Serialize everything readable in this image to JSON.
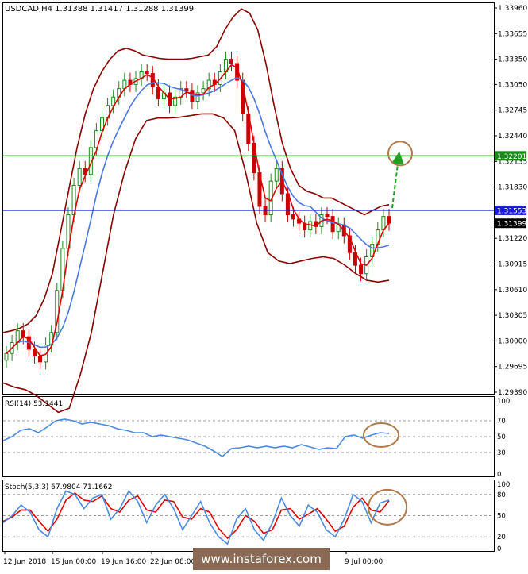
{
  "chart_data": [
    {
      "type": "line",
      "name": "price-panel",
      "title": "USDCAD,H4  1.31388 1.31417 1.31288 1.31399",
      "x_categories": [
        "12 Jun 2018",
        "15 Jun 00:00",
        "19 Jun 16:00",
        "22 Jun 08:00",
        "9 Jul 00:00"
      ],
      "y_ticks": [
        "1.33960",
        "1.33655",
        "1.33350",
        "1.33050",
        "1.32745",
        "1.32440",
        "1.32135",
        "1.31830",
        "1.31220",
        "1.30915",
        "1.30610",
        "1.30305",
        "1.30000",
        "1.29695",
        "1.29390"
      ],
      "ylim": [
        1.2939,
        1.3396
      ],
      "horizontal_levels": [
        {
          "value": 1.32201,
          "label": "1.32201",
          "color": "#1a8a1a"
        },
        {
          "value": 1.31553,
          "label": "1.31553",
          "color": "#1c1cd6"
        },
        {
          "value": 1.31399,
          "label": "1.31399",
          "color": "#000000"
        }
      ],
      "close_series": [
        1.2985,
        1.2998,
        1.3012,
        1.3005,
        1.299,
        1.2982,
        1.2975,
        1.2995,
        1.301,
        1.306,
        1.311,
        1.315,
        1.3185,
        1.3205,
        1.3198,
        1.323,
        1.325,
        1.3265,
        1.328,
        1.329,
        1.33,
        1.331,
        1.3305,
        1.3312,
        1.332,
        1.3318,
        1.3302,
        1.3288,
        1.3295,
        1.328,
        1.329,
        1.33,
        1.3298,
        1.3285,
        1.3295,
        1.33,
        1.331,
        1.3305,
        1.332,
        1.3335,
        1.333,
        1.331,
        1.327,
        1.3235,
        1.32,
        1.316,
        1.315,
        1.319,
        1.3205,
        1.3175,
        1.315,
        1.3145,
        1.314,
        1.3132,
        1.3142,
        1.3136,
        1.315,
        1.3148,
        1.313,
        1.3138,
        1.3125,
        1.3105,
        1.309,
        1.308,
        1.31,
        1.3115,
        1.3132,
        1.3148,
        1.314
      ],
      "bollinger_upper": [
        1.301,
        1.3012,
        1.3015,
        1.302,
        1.303,
        1.305,
        1.308,
        1.313,
        1.318,
        1.323,
        1.327,
        1.33,
        1.332,
        1.3335,
        1.3345,
        1.3348,
        1.3345,
        1.334,
        1.3338,
        1.3336,
        1.3335,
        1.3335,
        1.3335,
        1.3336,
        1.3338,
        1.334,
        1.335,
        1.337,
        1.3385,
        1.3395,
        1.339,
        1.337,
        1.333,
        1.328,
        1.3235,
        1.3205,
        1.3185,
        1.3178,
        1.3175,
        1.317,
        1.317,
        1.3165,
        1.316,
        1.3155,
        1.315,
        1.3155,
        1.316,
        1.3162
      ],
      "bollinger_lower": [
        1.295,
        1.2945,
        1.2942,
        1.2935,
        1.2925,
        1.2915,
        1.292,
        1.296,
        1.301,
        1.308,
        1.315,
        1.32,
        1.324,
        1.3262,
        1.3265,
        1.3265,
        1.3266,
        1.3268,
        1.327,
        1.327,
        1.3265,
        1.325,
        1.32,
        1.314,
        1.3105,
        1.3095,
        1.3092,
        1.3095,
        1.3098,
        1.31,
        1.3098,
        1.309,
        1.308,
        1.3072,
        1.307,
        1.3072
      ]
    },
    {
      "type": "line",
      "name": "rsi-panel",
      "title": "RSI(14) 53.1441",
      "y_ticks": [
        "70",
        "50",
        "30",
        "0",
        "100"
      ],
      "ylim": [
        0,
        100
      ],
      "series": [
        {
          "name": "RSI(14)",
          "values": [
            45,
            50,
            58,
            60,
            55,
            62,
            70,
            72,
            70,
            66,
            68,
            66,
            64,
            60,
            58,
            55,
            55,
            50,
            52,
            50,
            48,
            46,
            42,
            38,
            32,
            25,
            35,
            36,
            38,
            36,
            38,
            36,
            38,
            36,
            40,
            37,
            34,
            36,
            35,
            50,
            52,
            48,
            52,
            55,
            54
          ]
        }
      ]
    },
    {
      "type": "line",
      "name": "stochastic-panel",
      "title": "Stoch(5,3,3) 67.9804 71.1662",
      "y_ticks": [
        "80",
        "50",
        "20",
        "0",
        "100"
      ],
      "ylim": [
        0,
        100
      ],
      "series": [
        {
          "name": "Stoch %K",
          "values": [
            40,
            50,
            65,
            55,
            30,
            20,
            60,
            85,
            80,
            60,
            75,
            80,
            45,
            60,
            85,
            70,
            40,
            65,
            80,
            60,
            30,
            50,
            70,
            40,
            20,
            10,
            45,
            60,
            30,
            15,
            40,
            75,
            50,
            35,
            65,
            55,
            30,
            20,
            45,
            80,
            70,
            40,
            68,
            72
          ]
        },
        {
          "name": "Stoch %D",
          "values": [
            42,
            48,
            58,
            58,
            42,
            28,
            45,
            72,
            82,
            72,
            70,
            78,
            60,
            55,
            72,
            78,
            58,
            55,
            72,
            70,
            48,
            45,
            60,
            55,
            32,
            18,
            30,
            50,
            42,
            25,
            30,
            58,
            60,
            45,
            52,
            60,
            45,
            28,
            35,
            62,
            75,
            58,
            55,
            71
          ]
        }
      ]
    }
  ],
  "watermark": "www.instaforex.com",
  "colors": {
    "bollinger": "#8b0000",
    "ema_fast": "#e00000",
    "sma_slow": "#4a78e0",
    "bull_candle": "#1a8a1a",
    "bear_candle": "#cc0000",
    "forecast_arrow": "#22a022",
    "annotation_circle": "#b07a4a",
    "rsi_line": "#4a8be0",
    "stoch_k": "#4a8be0",
    "stoch_d": "#e00000",
    "watermark_bg": "#8b6a55"
  }
}
